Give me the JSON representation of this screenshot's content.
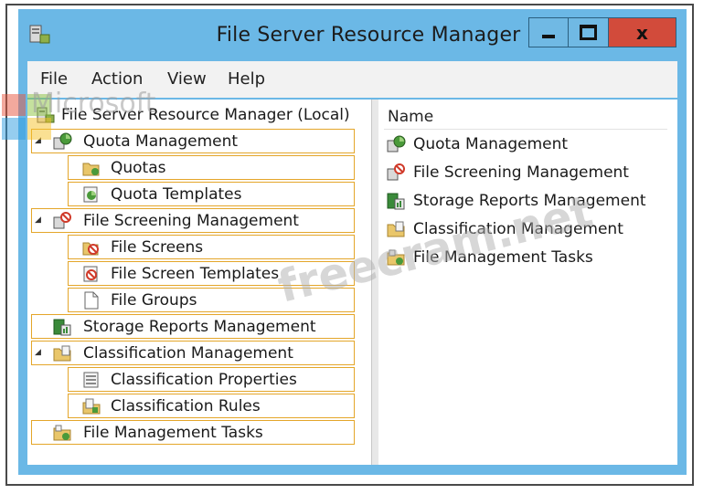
{
  "window": {
    "title": "File Server Resource Manager",
    "close_glyph": "x"
  },
  "menu": {
    "items": [
      "File",
      "Action",
      "View",
      "Help"
    ]
  },
  "tree": {
    "root": {
      "label": "File Server Resource Manager (Local)",
      "icon": "server-icon"
    },
    "nodes": [
      {
        "label": "Quota Management",
        "icon": "quota-management-icon",
        "level": 1,
        "expanded": true
      },
      {
        "label": "Quotas",
        "icon": "quotas-icon",
        "level": 2
      },
      {
        "label": "Quota Templates",
        "icon": "quota-templates-icon",
        "level": 2
      },
      {
        "label": "File Screening Management",
        "icon": "file-screening-icon",
        "level": 1,
        "expanded": true
      },
      {
        "label": "File Screens",
        "icon": "file-screens-icon",
        "level": 2
      },
      {
        "label": "File Screen Templates",
        "icon": "file-screen-templates-icon",
        "level": 2
      },
      {
        "label": "File Groups",
        "icon": "file-groups-icon",
        "level": 2
      },
      {
        "label": "Storage Reports Management",
        "icon": "storage-reports-icon",
        "level": 1
      },
      {
        "label": "Classification Management",
        "icon": "classification-icon",
        "level": 1,
        "expanded": true
      },
      {
        "label": "Classification Properties",
        "icon": "classification-properties-icon",
        "level": 2
      },
      {
        "label": "Classification Rules",
        "icon": "classification-rules-icon",
        "level": 2
      },
      {
        "label": "File Management Tasks",
        "icon": "file-management-tasks-icon",
        "level": 1
      }
    ]
  },
  "list": {
    "column_header": "Name",
    "items": [
      {
        "label": "Quota Management",
        "icon": "quota-management-icon"
      },
      {
        "label": "File Screening Management",
        "icon": "file-screening-icon"
      },
      {
        "label": "Storage Reports Management",
        "icon": "storage-reports-icon"
      },
      {
        "label": "Classification Management",
        "icon": "classification-icon"
      },
      {
        "label": "File Management Tasks",
        "icon": "file-management-tasks-icon"
      }
    ]
  },
  "watermark": {
    "brand": "Microsoft",
    "site": "freecram.net"
  },
  "colors": {
    "window_frame": "#6bb8e6",
    "close_button": "#d24b3b",
    "highlight_border": "#e4a62a"
  }
}
